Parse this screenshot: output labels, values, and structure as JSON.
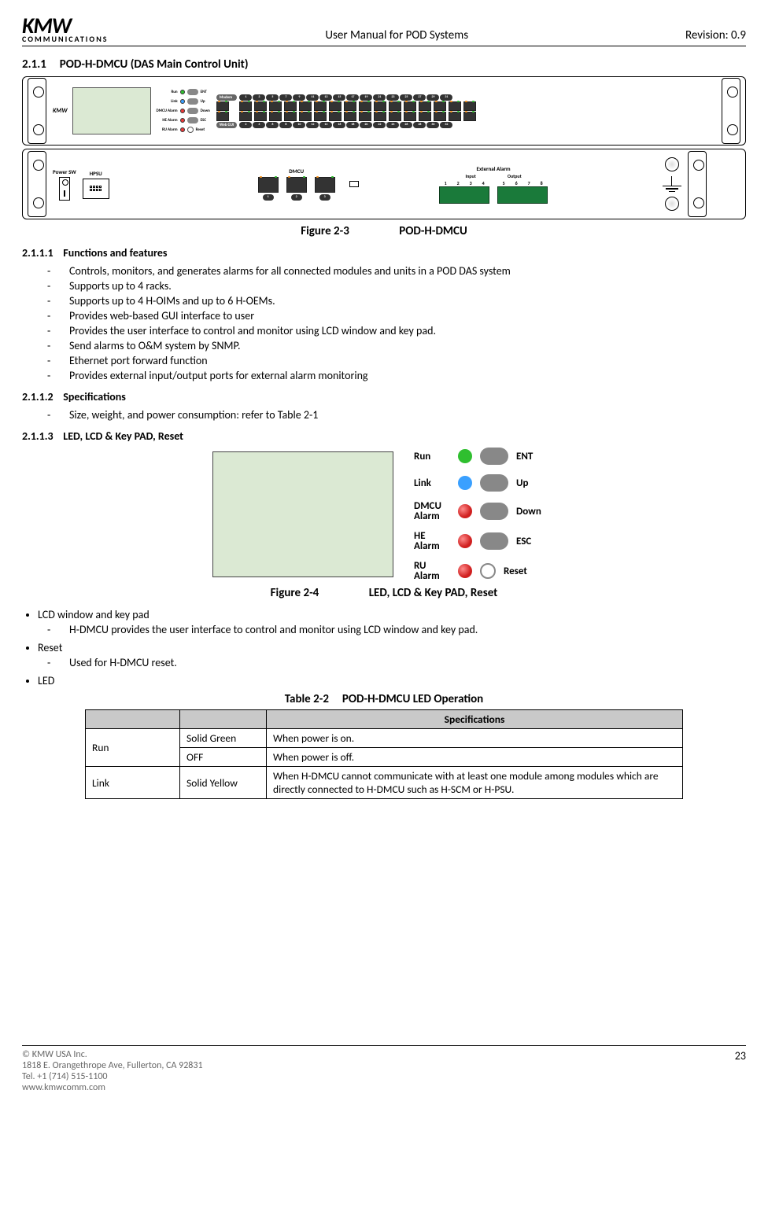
{
  "header": {
    "logo_top": "KMW",
    "logo_sub": "COMMUNICATIONS",
    "center": "User Manual for POD Systems",
    "right": "Revision: 0.9"
  },
  "sections": {
    "s211_num": "2.1.1",
    "s211_title": "POD-H-DMCU (DAS Main Control Unit)",
    "s2111_num": "2.1.1.1",
    "s2111_title": "Functions and features",
    "s2112_num": "2.1.1.2",
    "s2112_title": "Specifications",
    "s2113_num": "2.1.1.3",
    "s2113_title": "LED, LCD & Key PAD, Reset"
  },
  "figures": {
    "f23_label": "Figure 2-3",
    "f23_title": "POD-H-DMCU",
    "f24_label": "Figure 2-4",
    "f24_title": "LED, LCD & Key PAD, Reset"
  },
  "front_panel": {
    "brand": "KMW",
    "led_rows": [
      {
        "left": "Run",
        "color": "g",
        "right": "ENT",
        "btn": "pill"
      },
      {
        "left": "Link",
        "color": "b",
        "right": "Up",
        "btn": "pill"
      },
      {
        "left": "DMCU Alarm",
        "color": "r",
        "right": "Down",
        "btn": "pill"
      },
      {
        "left": "HE Alarm",
        "color": "r",
        "right": "ESC",
        "btn": "pill"
      },
      {
        "left": "RU Alarm",
        "color": "r",
        "right": "Reset",
        "btn": "o"
      }
    ],
    "modem_label": "Modem",
    "webgui_label": "Web GUI",
    "top_numbers": [
      1,
      3,
      5,
      7,
      9,
      11,
      13,
      15,
      17,
      19,
      21,
      23,
      25,
      27,
      29,
      31
    ],
    "bottom_numbers": [
      2,
      4,
      6,
      8,
      10,
      12,
      14,
      16,
      18,
      20,
      22,
      24,
      26,
      28,
      30,
      32
    ]
  },
  "back_panel": {
    "power_sw": "Power SW",
    "hpsu": "HPSU",
    "dmcu": "DMCU",
    "dmcu_nums": [
      1,
      2,
      3
    ],
    "ext_alarm": "External Alarm",
    "input": "Input",
    "output": "Output",
    "input_nums": [
      1,
      2,
      3,
      4
    ],
    "output_nums": [
      5,
      6,
      7,
      8
    ]
  },
  "functions": [
    "Controls,  monitors, and generates alarms for all connected modules and units in a POD DAS system",
    "Supports up to 4 racks.",
    "Supports up to 4 H-OIMs and up to 6 H-OEMs.",
    "Provides web-based GUI interface to user",
    "Provides the user interface to control and monitor using LCD window and key pad.",
    "Send alarms to O&M system by SNMP.",
    "Ethernet port forward function",
    "Provides external input/output ports for external alarm monitoring"
  ],
  "specifications": [
    "Size, weight, and power consumption: refer to Table 2-1"
  ],
  "fig24_rows": [
    {
      "ll": "Run",
      "col": "g",
      "rl": "ENT",
      "btn": "btn"
    },
    {
      "ll": "Link",
      "col": "b",
      "rl": "Up",
      "btn": "btn"
    },
    {
      "ll": "DMCU\nAlarm",
      "col": "r",
      "rl": "Down",
      "btn": "btn"
    },
    {
      "ll": "HE\nAlarm",
      "col": "r",
      "rl": "ESC",
      "btn": "btn"
    },
    {
      "ll": "RU\nAlarm",
      "col": "r",
      "rl": "Reset",
      "btn": "btn-o"
    }
  ],
  "bullets": {
    "lcd": "LCD window and key pad",
    "lcd_sub": "H-DMCU provides the user interface to control and monitor using LCD window and key pad.",
    "reset": "Reset",
    "reset_sub": "Used for H-DMCU reset.",
    "led": "LED"
  },
  "table": {
    "caption_label": "Table 2-2",
    "caption_title": "POD-H-DMCU LED Operation",
    "header_spec": "Specifications",
    "rows": [
      {
        "c1": "Run",
        "c2": "Solid Green",
        "c3": "When power is on.",
        "rowspan": 2
      },
      {
        "c1": "",
        "c2": "OFF",
        "c3": "When power is off."
      },
      {
        "c1": "Link",
        "c2": "Solid Yellow",
        "c3": "When H-DMCU cannot communicate with at least one module among modules which are directly connected to H-DMCU such as H-SCM or H-PSU."
      }
    ]
  },
  "footer": {
    "copyright": "©  KMW USA Inc.",
    "addr1": "1818 E. Orangethrope Ave, Fullerton, CA 92831",
    "tel": "Tel. +1 (714) 515-1100",
    "web": "www.kmwcomm.com",
    "page": "23"
  }
}
